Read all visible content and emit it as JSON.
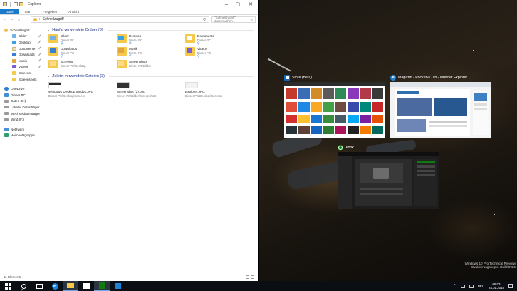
{
  "explorer": {
    "title": "Explorer",
    "ribbon_tabs": [
      "Datei",
      "Start",
      "Freigeben",
      "Ansicht"
    ],
    "address": "Schnellzugriff",
    "search_placeholder": "\"Schnellzugriff\" durchsuchen",
    "nav": [
      {
        "label": "Schnellzugriff",
        "icon": "star-icon",
        "level": 0,
        "pinned": false
      },
      {
        "label": "Bilder",
        "icon": "pictures-icon",
        "level": 1,
        "pinned": true
      },
      {
        "label": "Desktop",
        "icon": "desktop-icon",
        "level": 1,
        "pinned": true
      },
      {
        "label": "Dokumente",
        "icon": "documents-icon",
        "level": 1,
        "pinned": true
      },
      {
        "label": "Downloads",
        "icon": "downloads-icon",
        "level": 1,
        "pinned": true
      },
      {
        "label": "Musik",
        "icon": "music-icon",
        "level": 1,
        "pinned": true
      },
      {
        "label": "Videos",
        "icon": "videos-icon",
        "level": 1,
        "pinned": true
      },
      {
        "label": "Screens",
        "icon": "folder-icon",
        "level": 1,
        "pinned": false
      },
      {
        "label": "Screenshots",
        "icon": "folder-icon",
        "level": 1,
        "pinned": false
      },
      {
        "label": "OneDrive",
        "icon": "onedrive-icon",
        "level": 0,
        "pinned": false
      },
      {
        "label": "Dieser PC",
        "icon": "pc-icon",
        "level": 0,
        "pinned": false
      },
      {
        "label": "Daten (D:)",
        "icon": "drive-icon",
        "level": 0,
        "pinned": false
      },
      {
        "label": "Lokaler Datenträger",
        "icon": "drive-icon",
        "level": 0,
        "pinned": false
      },
      {
        "label": "Wechseldatenträger",
        "icon": "drive-icon",
        "level": 0,
        "pinned": false
      },
      {
        "label": "Wind (F:)",
        "icon": "drive-icon",
        "level": 0,
        "pinned": false
      },
      {
        "label": "Netzwerk",
        "icon": "network-icon",
        "level": 0,
        "pinned": false
      },
      {
        "label": "Heimnetzgruppe",
        "icon": "homegroup-icon",
        "level": 0,
        "pinned": false
      }
    ],
    "frequent_header": "Häufig verwendete Ordner (8)",
    "frequent": [
      {
        "name": "Bilder",
        "sub": "Dieser PC",
        "kind": "pic",
        "pinned": true
      },
      {
        "name": "Desktop",
        "sub": "Dieser PC",
        "kind": "desk",
        "pinned": true
      },
      {
        "name": "Dokumente",
        "sub": "Dieser PC",
        "kind": "doc",
        "pinned": true
      },
      {
        "name": "Downloads",
        "sub": "Dieser PC",
        "kind": "down",
        "pinned": true
      },
      {
        "name": "Musik",
        "sub": "Dieser PC",
        "kind": "music",
        "pinned": true
      },
      {
        "name": "Videos",
        "sub": "Dieser PC",
        "kind": "video",
        "pinned": true
      },
      {
        "name": "Screens",
        "sub": "Dieser PC\\Desktop",
        "kind": "folder",
        "pinned": false
      },
      {
        "name": "Screenshots",
        "sub": "Dieser PC\\Bilder",
        "kind": "folder",
        "pinned": false
      }
    ],
    "recent_header": "Zuletzt verwendete Dateien (3)",
    "recent": [
      {
        "name": "Windows Desktop Modus.JPG",
        "sub": "Dieser PC\\Desktop\\Screens",
        "thumb": "white"
      },
      {
        "name": "Screenshot (2).png",
        "sub": "Dieser PC\\Bilder\\Screenshots",
        "thumb": "dark"
      },
      {
        "name": "Explorer.JPG",
        "sub": "Dieser PC\\Desktop\\Screens",
        "thumb": "light"
      }
    ],
    "status": "11 Elemente"
  },
  "snap": {
    "store_title": "Store (Beta)",
    "ie_title": "Magazin - PocketPC.ch - Internet Explorer",
    "xbox_title": "Xbox"
  },
  "watermark": {
    "line1": "Windows 10 Pro Technical Preview",
    "line2": "Evaluierungskopie. Build 9926"
  },
  "taskbar": {
    "time": "09:03",
    "date": "24.01.2015",
    "lang": "DEU"
  },
  "colors": {
    "accent": "#1979ca",
    "xbox_green": "#107c10"
  }
}
